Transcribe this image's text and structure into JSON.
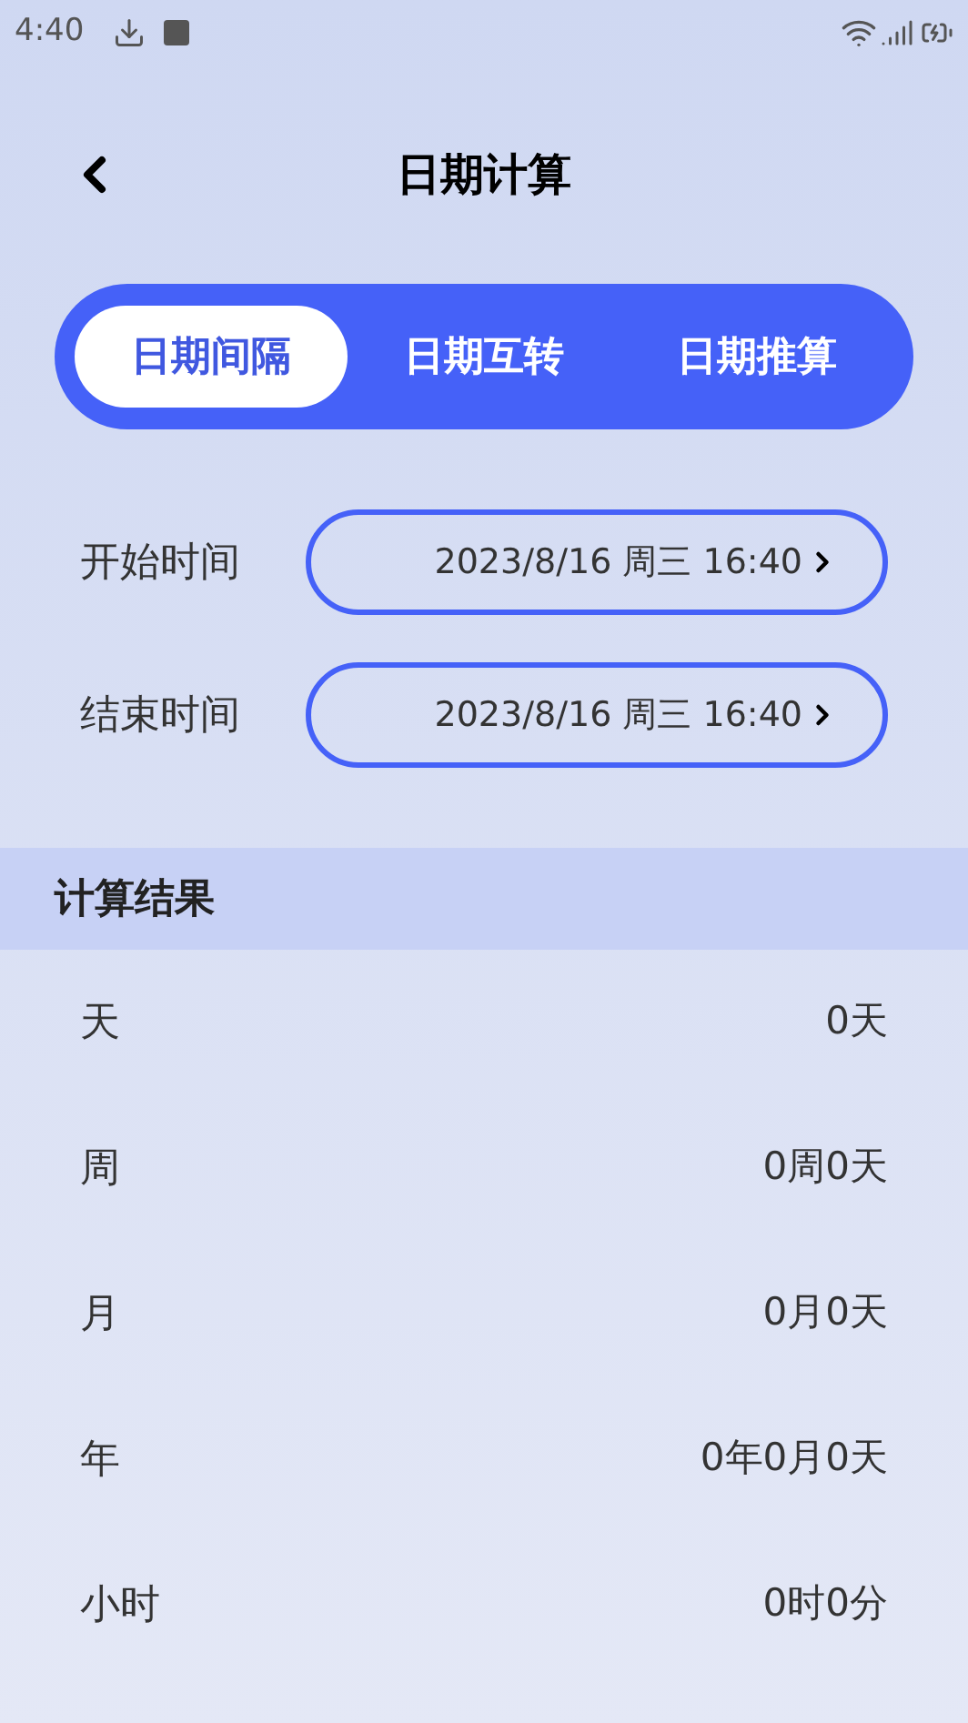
{
  "status_bar": {
    "time": "4:40"
  },
  "header": {
    "title": "日期计算"
  },
  "tabs": [
    {
      "label": "日期间隔",
      "selected": true
    },
    {
      "label": "日期互转",
      "selected": false
    },
    {
      "label": "日期推算",
      "selected": false
    }
  ],
  "inputs": [
    {
      "label": "开始时间",
      "value": "2023/8/16 周三 16:40"
    },
    {
      "label": "结束时间",
      "value": "2023/8/16 周三 16:40"
    }
  ],
  "results": {
    "title": "计算结果",
    "rows": [
      {
        "label": "天",
        "value": "0天"
      },
      {
        "label": "周",
        "value": "0周0天"
      },
      {
        "label": "月",
        "value": "0月0天"
      },
      {
        "label": "年",
        "value": "0年0月0天"
      },
      {
        "label": "小时",
        "value": "0时0分"
      }
    ]
  }
}
